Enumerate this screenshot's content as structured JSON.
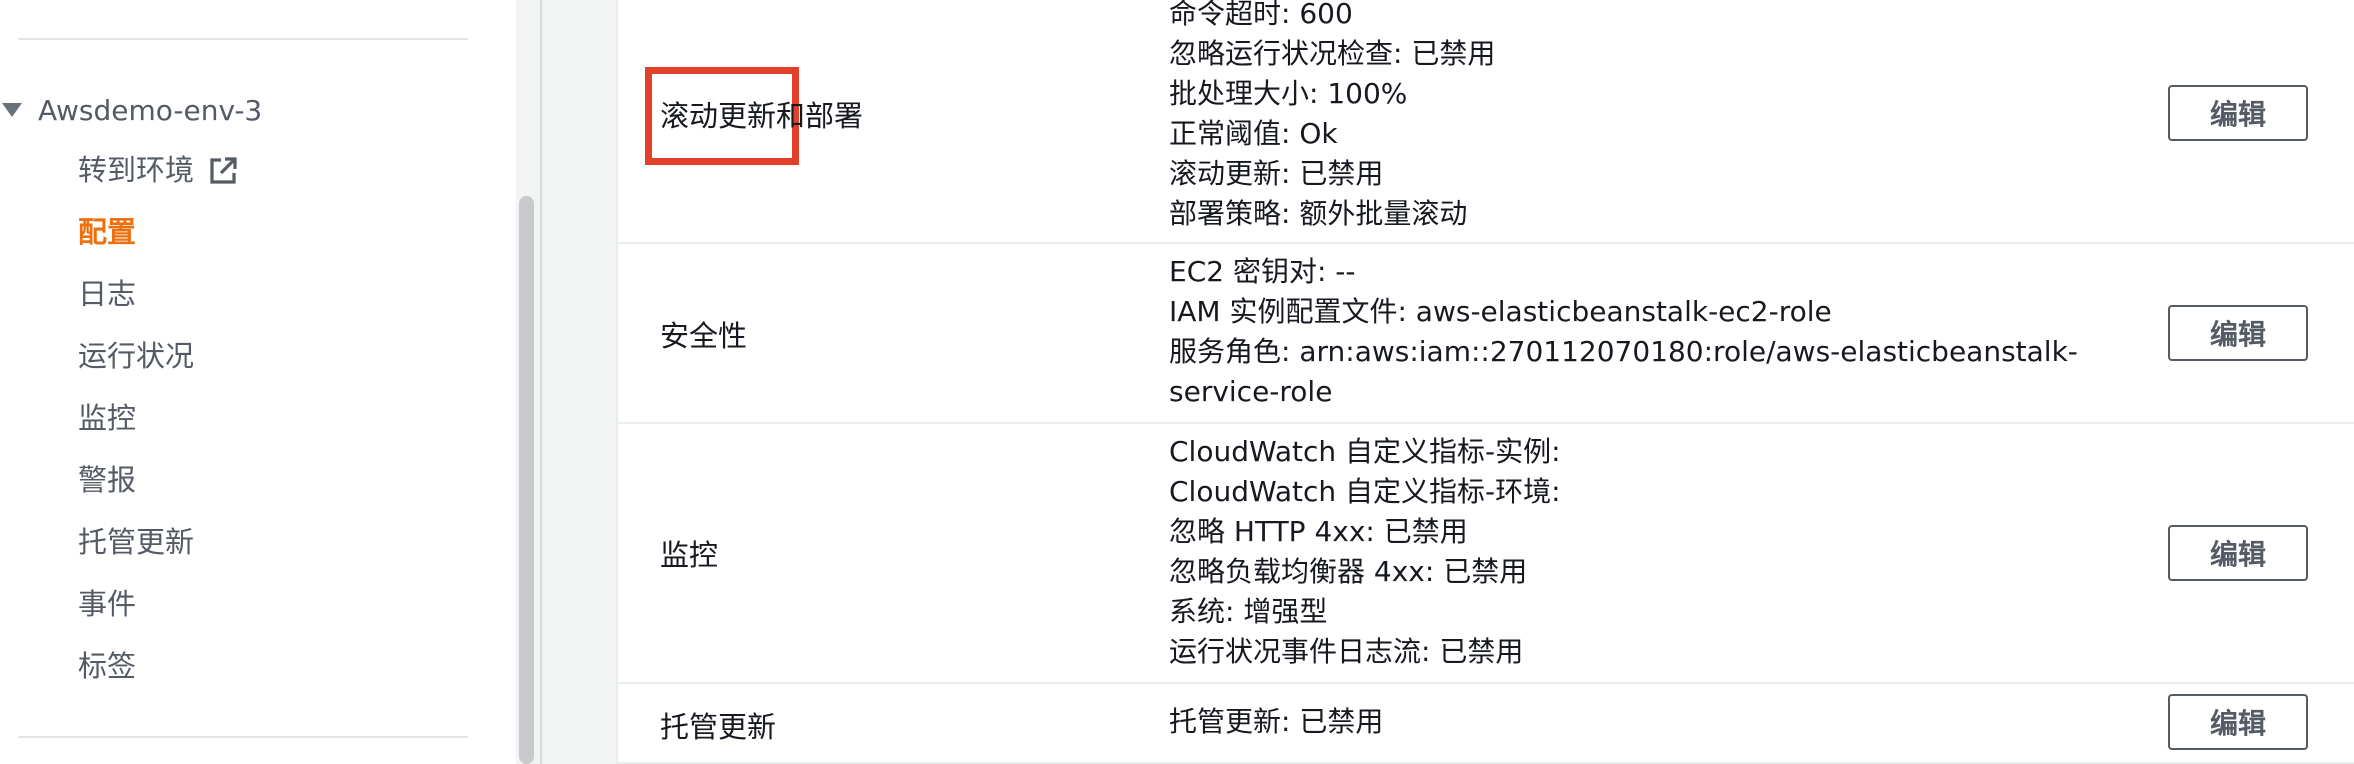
{
  "sidebar": {
    "environment_name": "Awsdemo-env-3",
    "items": [
      {
        "label": "转到环境",
        "icon": "external-link-icon",
        "active": false
      },
      {
        "label": "配置",
        "active": true
      },
      {
        "label": "日志",
        "active": false
      },
      {
        "label": "运行状况",
        "active": false
      },
      {
        "label": "监控",
        "active": false
      },
      {
        "label": "警报",
        "active": false
      },
      {
        "label": "托管更新",
        "active": false
      },
      {
        "label": "事件",
        "active": false
      },
      {
        "label": "标签",
        "active": false
      }
    ],
    "active_color": "#ec7211"
  },
  "config_rows": [
    {
      "label": "滚动更新和部署",
      "highlighted": true,
      "values": [
        "命令超时: 600",
        "忽略运行状况检查: 已禁用",
        "批处理大小: 100%",
        "正常阈值: Ok",
        "滚动更新: 已禁用",
        "部署策略: 额外批量滚动"
      ],
      "edit_label": "编辑"
    },
    {
      "label": "安全性",
      "values": [
        "EC2 密钥对: --",
        "IAM 实例配置文件: aws-elasticbeanstalk-ec2-role",
        "服务角色: arn:aws:iam::270112070180:role/aws-elasticbeanstalk-",
        "service-role"
      ],
      "edit_label": "编辑"
    },
    {
      "label": "监控",
      "values": [
        "CloudWatch 自定义指标-实例:",
        "CloudWatch 自定义指标-环境:",
        "忽略 HTTP 4xx: 已禁用",
        "忽略负载均衡器 4xx: 已禁用",
        "系统: 增强型",
        "运行状况事件日志流: 已禁用"
      ],
      "edit_label": "编辑"
    },
    {
      "label": "托管更新",
      "values": [
        "托管更新: 已禁用"
      ],
      "edit_label": "编辑"
    }
  ],
  "highlight_color": "#e3402b"
}
